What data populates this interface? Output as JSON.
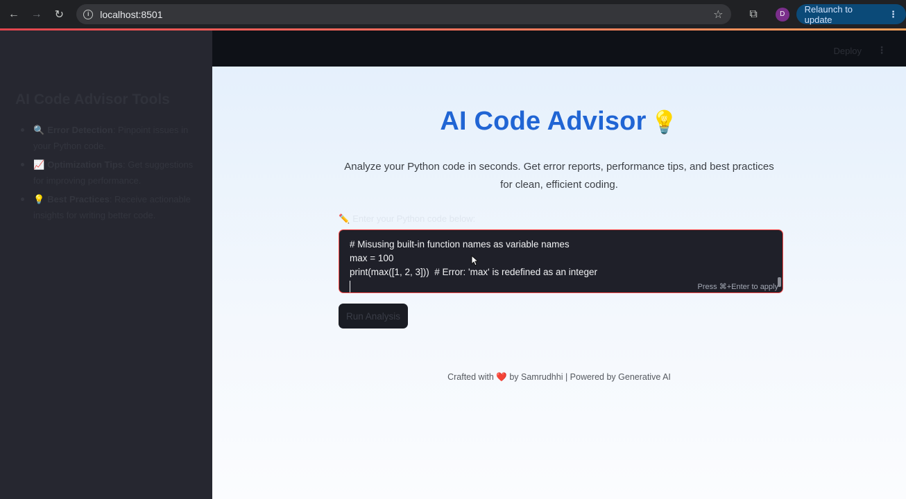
{
  "browser": {
    "url": "localhost:8501",
    "relaunch_label": "Relaunch to update",
    "profile_initial": "D"
  },
  "sidebar": {
    "title": "AI Code Advisor Tools",
    "items": [
      {
        "emoji": "🔍",
        "bold": "Error Detection",
        "text": ": Pinpoint issues in your Python code."
      },
      {
        "emoji": "📈",
        "bold": "Optimization Tips",
        "text": ": Get suggestions for improving performance."
      },
      {
        "emoji": "💡",
        "bold": "Best Practices",
        "text": ": Receive actionable insights for writing better code."
      }
    ]
  },
  "header": {
    "deploy_label": "Deploy"
  },
  "main": {
    "title": "AI Code Advisor",
    "title_emoji": "💡",
    "subtitle": "Analyze your Python code in seconds. Get error reports, performance tips, and best practices for clean, efficient coding.",
    "input_label_emoji": "✏️",
    "input_label": "Enter your Python code below:",
    "code_lines": [
      "# Misusing built-in function names as variable names",
      "max = 100",
      "print(max([1, 2, 3]))  # Error: 'max' is redefined as an integer"
    ],
    "input_hint": "Press ⌘+Enter to apply",
    "run_button_label": "Run Analysis",
    "footer_prefix": "Crafted with",
    "footer_heart": "❤️",
    "footer_suffix": "by Samrudhhi | Powered by Generative AI"
  },
  "colors": {
    "title_blue": "#2065d4",
    "error_border": "#ff4b4b",
    "sidebar_bg": "#262730",
    "code_bg": "#1f2029"
  }
}
